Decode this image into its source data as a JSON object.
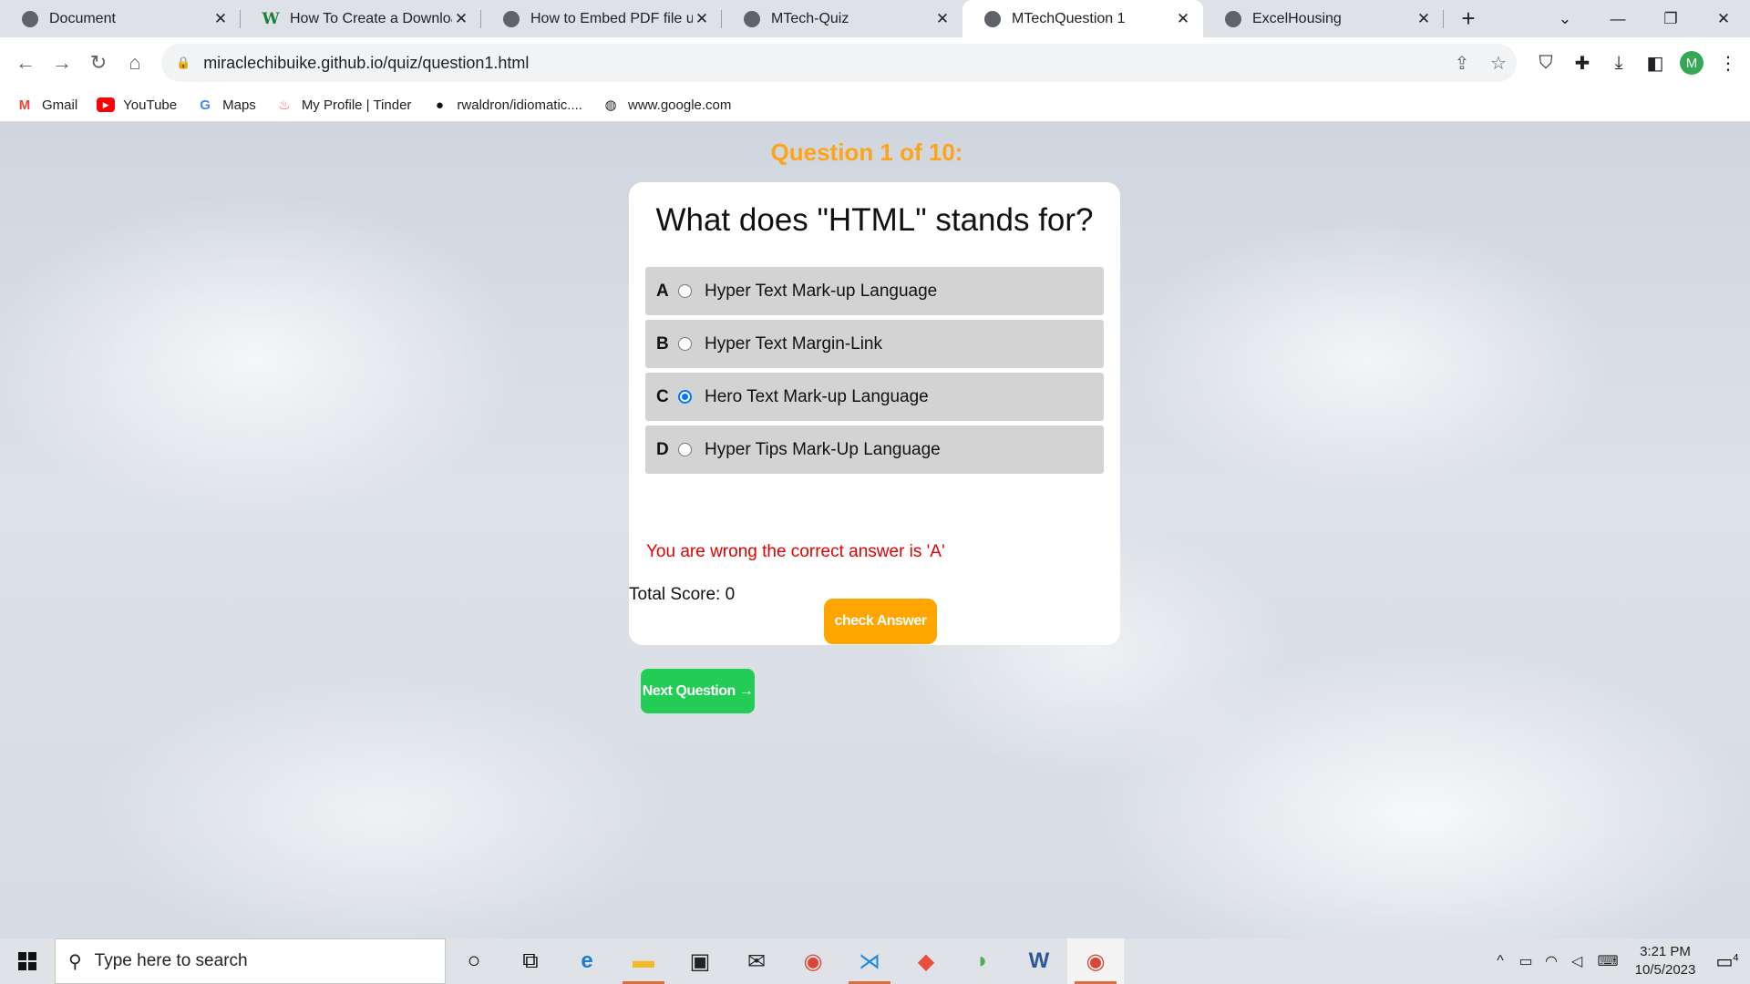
{
  "browser": {
    "tabs": [
      {
        "title": "Document",
        "favicon": "globe-icon",
        "active": false
      },
      {
        "title": "How To Create a Downloac",
        "favicon": "w-logo-icon",
        "active": false
      },
      {
        "title": "How to Embed PDF file usi",
        "favicon": "globe-icon",
        "active": false
      },
      {
        "title": "MTech-Quiz",
        "favicon": "globe-icon",
        "active": false
      },
      {
        "title": "MTechQuestion 1",
        "favicon": "globe-icon",
        "active": true
      },
      {
        "title": "ExcelHousing",
        "favicon": "globe-icon",
        "active": false
      }
    ],
    "url": "miraclechibuike.github.io/quiz/question1.html",
    "profile_initial": "M",
    "bookmarks": [
      {
        "label": "Gmail",
        "icon": "gmail-icon"
      },
      {
        "label": "YouTube",
        "icon": "youtube-icon"
      },
      {
        "label": "Maps",
        "icon": "google-icon"
      },
      {
        "label": "My Profile | Tinder",
        "icon": "tinder-icon"
      },
      {
        "label": "rwaldron/idiomatic....",
        "icon": "github-icon"
      },
      {
        "label": "www.google.com",
        "icon": "globe-icon"
      }
    ]
  },
  "quiz": {
    "heading": "Question 1 of 10:",
    "question": "What does \"HTML\" stands for?",
    "options": [
      {
        "letter": "A",
        "text": "Hyper Text Mark-up Language",
        "checked": false
      },
      {
        "letter": "B",
        "text": "Hyper Text Margin-Link",
        "checked": false
      },
      {
        "letter": "C",
        "text": "Hero Text Mark-up Language",
        "checked": true
      },
      {
        "letter": "D",
        "text": "Hyper Tips Mark-Up Language",
        "checked": false
      }
    ],
    "feedback": "You are wrong the correct answer is 'A'",
    "score": "Total Score: 0",
    "check_label": "check Answer",
    "next_label": "Next Question →"
  },
  "taskbar": {
    "search_placeholder": "Type here to search",
    "time": "3:21 PM",
    "date": "10/5/2023",
    "notification_count": "4"
  }
}
